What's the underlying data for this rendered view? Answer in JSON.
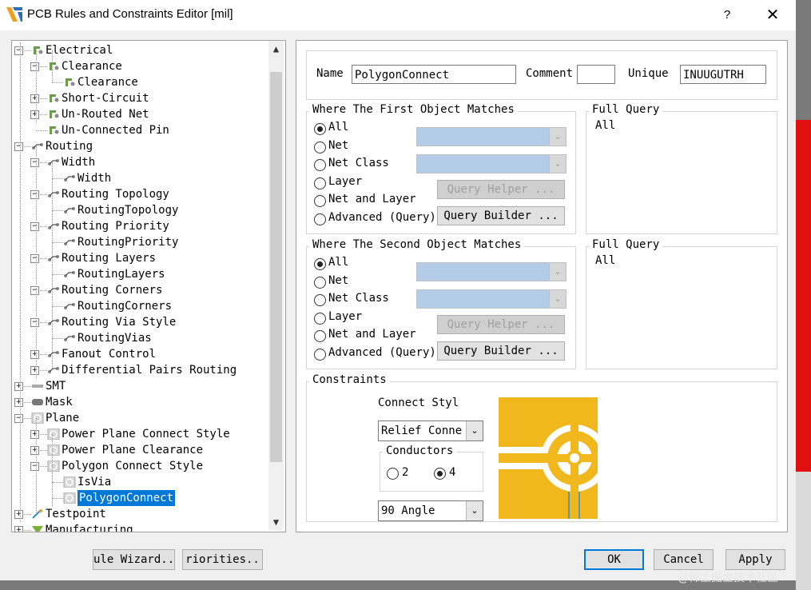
{
  "window": {
    "title": "PCB Rules and Constraints Editor [mil]",
    "help": "?",
    "close": "✕"
  },
  "tree": {
    "nodes": [
      {
        "label": "Electrical",
        "icon": "electrical-icon"
      },
      {
        "label": "Clearance",
        "icon": "electrical-icon"
      },
      {
        "label": "Clearance",
        "icon": "electrical-icon"
      },
      {
        "label": "Short-Circuit",
        "icon": "electrical-icon"
      },
      {
        "label": "Un-Routed Net",
        "icon": "electrical-icon"
      },
      {
        "label": "Un-Connected Pin",
        "icon": "electrical-icon"
      },
      {
        "label": "Routing",
        "icon": "routing-icon"
      },
      {
        "label": "Width",
        "icon": "routing-icon"
      },
      {
        "label": "Width",
        "icon": "routing-icon"
      },
      {
        "label": "Routing Topology",
        "icon": "routing-icon"
      },
      {
        "label": "RoutingTopology",
        "icon": "routing-icon"
      },
      {
        "label": "Routing Priority",
        "icon": "routing-icon"
      },
      {
        "label": "RoutingPriority",
        "icon": "routing-icon"
      },
      {
        "label": "Routing Layers",
        "icon": "routing-icon"
      },
      {
        "label": "RoutingLayers",
        "icon": "routing-icon"
      },
      {
        "label": "Routing Corners",
        "icon": "routing-icon"
      },
      {
        "label": "RoutingCorners",
        "icon": "routing-icon"
      },
      {
        "label": "Routing Via Style",
        "icon": "routing-icon"
      },
      {
        "label": "RoutingVias",
        "icon": "routing-icon"
      },
      {
        "label": "Fanout Control",
        "icon": "routing-icon"
      },
      {
        "label": "Differential Pairs Routing",
        "icon": "routing-icon"
      },
      {
        "label": "SMT",
        "icon": "smt-icon"
      },
      {
        "label": "Mask",
        "icon": "mask-icon"
      },
      {
        "label": "Plane",
        "icon": "plane-icon"
      },
      {
        "label": "Power Plane Connect Style",
        "icon": "plane-icon"
      },
      {
        "label": "Power Plane Clearance",
        "icon": "plane-icon"
      },
      {
        "label": "Polygon Connect Style",
        "icon": "plane-icon"
      },
      {
        "label": "IsVia",
        "icon": "plane-icon"
      },
      {
        "label": "PolygonConnect",
        "icon": "plane-icon"
      },
      {
        "label": "Testpoint",
        "icon": "testpoint-icon"
      },
      {
        "label": "Manufacturing",
        "icon": "manufacturing-icon"
      }
    ]
  },
  "rule": {
    "name_label": "Name",
    "name_value": "PolygonConnect",
    "comment_label": "Comment",
    "comment_value": "",
    "unique_label": "Unique",
    "unique_value": "INUUGUTRH"
  },
  "first": {
    "title": "Where The First Object Matches",
    "options": [
      "All",
      "Net",
      "Net Class",
      "Layer",
      "Net and Layer",
      "Advanced (Query)"
    ],
    "selected": "All",
    "query_helper": "Query Helper ...",
    "query_builder": "Query Builder ...",
    "full_query_title": "Full Query",
    "full_query": "All"
  },
  "second": {
    "title": "Where The Second Object Matches",
    "options": [
      "All",
      "Net",
      "Net Class",
      "Layer",
      "Net and Layer",
      "Advanced (Query)"
    ],
    "selected": "All",
    "query_helper": "Query Helper ...",
    "query_builder": "Query Builder ...",
    "full_query_title": "Full Query",
    "full_query": "All"
  },
  "constraints": {
    "title": "Constraints",
    "connect_style_label": "Connect Styl",
    "connect_style_value": "Relief Conne",
    "conductors_title": "Conductors",
    "conductor_options": [
      "2",
      "4"
    ],
    "conductor_selected": "4",
    "angle_value": "90 Angle",
    "colors": {
      "copper": "#f0b81c",
      "pad_ring": "#f0b81c",
      "gap": "#ffffff"
    }
  },
  "footer": {
    "rule_wizard": "ule Wizard..",
    "priorities": "riorities..",
    "ok": "OK",
    "cancel": "Cancel",
    "apply": "Apply",
    "watermark": "@稀土掘金技术社区"
  }
}
